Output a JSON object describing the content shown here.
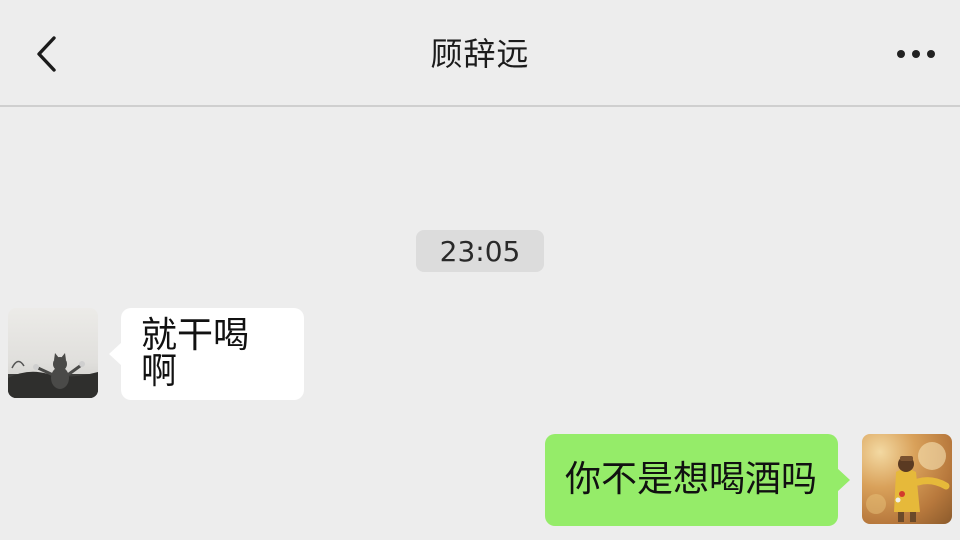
{
  "header": {
    "back_icon": "chevron-left-icon",
    "title": "顾辞远",
    "more_icon": "more-horizontal-icon"
  },
  "chat": {
    "timestamp": "23:05",
    "messages": [
      {
        "sender": "friend",
        "text": "就干喝啊"
      },
      {
        "sender": "me",
        "text": "你不是想喝酒吗"
      }
    ]
  },
  "colors": {
    "background": "#ededed",
    "incoming_bubble": "#ffffff",
    "outgoing_bubble": "#95ec69",
    "timestamp_chip": "#dcdcdc"
  }
}
